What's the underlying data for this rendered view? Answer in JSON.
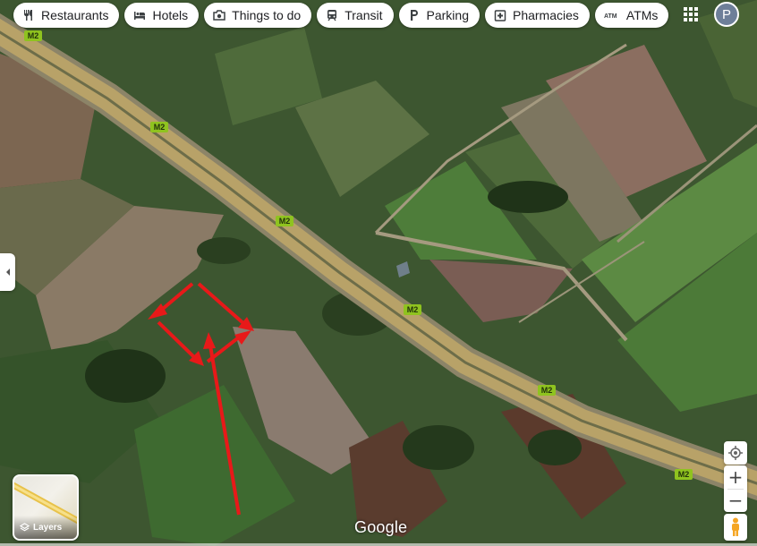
{
  "categories": [
    {
      "label": "Restaurants",
      "icon": "fork-knife-icon"
    },
    {
      "label": "Hotels",
      "icon": "bed-icon"
    },
    {
      "label": "Things to do",
      "icon": "camera-icon"
    },
    {
      "label": "Transit",
      "icon": "train-icon"
    },
    {
      "label": "Parking",
      "icon": "parking-icon"
    },
    {
      "label": "Pharmacies",
      "icon": "pharmacy-icon"
    },
    {
      "label": "ATMs",
      "icon": "atm-icon"
    }
  ],
  "account": {
    "initial": "P"
  },
  "road": {
    "shield": "M2"
  },
  "layers": {
    "label": "Layers"
  },
  "zoom": {
    "in": "+",
    "out": "−"
  },
  "branding": {
    "logo": "Google"
  },
  "colors": {
    "road": "#b8a268",
    "annotation": "#e81919",
    "shield": "#8fc31f"
  }
}
